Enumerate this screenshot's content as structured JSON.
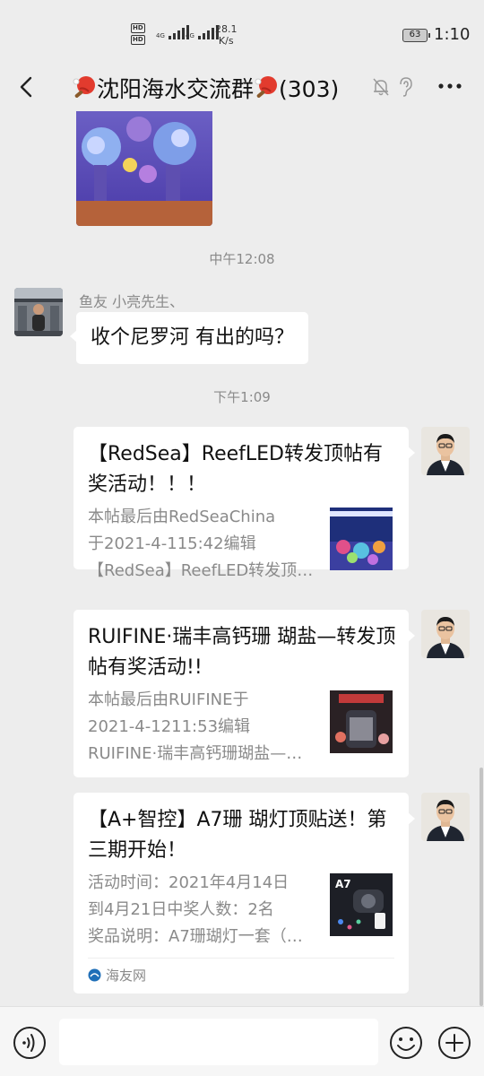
{
  "status_bar": {
    "hd1": "HD",
    "hd2": "HD",
    "net1": "4G",
    "net2": "4G",
    "speed_value": "28.1",
    "speed_unit": "K/s",
    "battery": "63",
    "time": "1:10"
  },
  "nav": {
    "title_main": "沈阳海水交流群",
    "member_count": "(303)",
    "icons": [
      "back-icon",
      "ping-pong-emoji",
      "mute-bell-icon",
      "ear-icon",
      "more-icon"
    ]
  },
  "messages": {
    "ts1": "中午12:08",
    "sender1": "鱼友 小亮先生、",
    "text1": "收个尼罗河 有出的吗？",
    "ts2": "下午1:09",
    "cards": [
      {
        "title": "【RedSea】ReefLED转发顶帖有奖活动！！！",
        "desc": [
          "本帖最后由RedSeaChina",
          "于2021-4-115:42编辑",
          "【RedSea】ReefLED转发顶帖有奖活动"
        ]
      },
      {
        "title": "RUIFINE·瑞丰高钙珊 瑚盐—转发顶帖有奖活动!!",
        "desc": [
          "本帖最后由RUIFINE于",
          "2021-4-1211:53编辑",
          "RUIFINE·瑞丰高钙珊瑚盐—转发顶帖"
        ]
      },
      {
        "title": "【A+智控】A7珊 瑚灯顶贴送！第三期开始！",
        "desc": [
          "活动时间：2021年4月14日",
          "到4月21日中奖人数：2名",
          "奖品说明：A7珊瑚灯一套（价值"
        ],
        "thumb_label": "A7",
        "source": "海友网"
      }
    ]
  },
  "input": {
    "placeholder": "",
    "icons": [
      "voice-icon",
      "emoji-icon",
      "plus-icon"
    ]
  },
  "colors": {
    "background": "#ededed",
    "bubble": "#ffffff",
    "meta_text": "#8a8a8a"
  }
}
